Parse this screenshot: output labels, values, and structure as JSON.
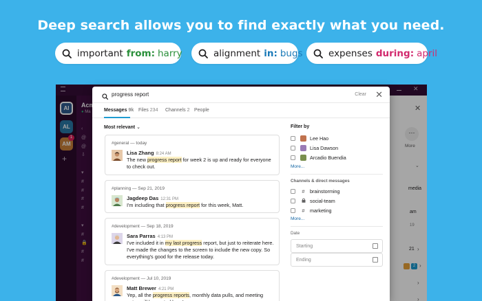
{
  "headline": "Deep search allows you to find exactly what you need.",
  "pills": [
    {
      "pre": "important",
      "kw": "from:",
      "val": "harry",
      "color": "green"
    },
    {
      "pre": "alignment",
      "kw": "in:",
      "val": "bugs",
      "color": "blue"
    },
    {
      "pre": "expenses",
      "kw": "during:",
      "val": "april",
      "color": "pink"
    }
  ],
  "app": {
    "workspaces": [
      "AI",
      "AL",
      "AM"
    ],
    "badge": "1",
    "add": "+",
    "sidebar_title": "Acm",
    "sidebar_status": "Ma",
    "right": {
      "more": "More",
      "media": "media",
      "am": "am",
      "time": "19",
      "c21": "21",
      "c2": "2"
    }
  },
  "search": {
    "query": "progress report",
    "clear": "Clear",
    "close": "✕"
  },
  "tabs": [
    {
      "label": "Messages",
      "count": "9k"
    },
    {
      "label": "Files",
      "count": "234"
    },
    {
      "label": "Channels",
      "count": "2"
    },
    {
      "label": "People",
      "count": ""
    }
  ],
  "sort_label": "Most relevant",
  "results": [
    {
      "context": "#general — today",
      "name": "Lisa Zhang",
      "time": "8:24 AM",
      "pre": "The new ",
      "hl": "progress report",
      "post": " for week 2 is up and ready for everyone to check out."
    },
    {
      "context": "#planning — Sep 21, 2019",
      "name": "Jagdeep Das",
      "time": "12:31 PM",
      "pre": "I'm including that ",
      "hl": "progress report",
      "post": " for this week, Matt."
    },
    {
      "context": "#development — Sep 18, 2019",
      "name": "Sara Parras",
      "time": "4:13 PM",
      "pre": "I've included it in ",
      "hl": "my last progress",
      "post": " report, but just to reiterate here. I've made the changes to the screen to include the new copy. So everything's good for the release today."
    },
    {
      "context": "#development — Jul 10, 2019",
      "name": "Matt Brewer",
      "time": "4:21 PM",
      "pre": "Yep, all the ",
      "hl": "progress reports",
      "post": ", monthly data pulls, and meeting notes will be posted here!"
    }
  ],
  "filters": {
    "title": "Filter by",
    "people": [
      "Lee Hao",
      "Lisa Dawson",
      "Arcadio Buendia"
    ],
    "people_more": "More...",
    "channels_title": "Channels & direct messages",
    "channels": [
      {
        "name": "brainstorming",
        "icon": "#"
      },
      {
        "name": "social-team",
        "icon": "lock"
      },
      {
        "name": "marketing",
        "icon": "#"
      }
    ],
    "channels_more": "More...",
    "date_title": "Date",
    "starting": "Starting",
    "ending": "Ending"
  }
}
